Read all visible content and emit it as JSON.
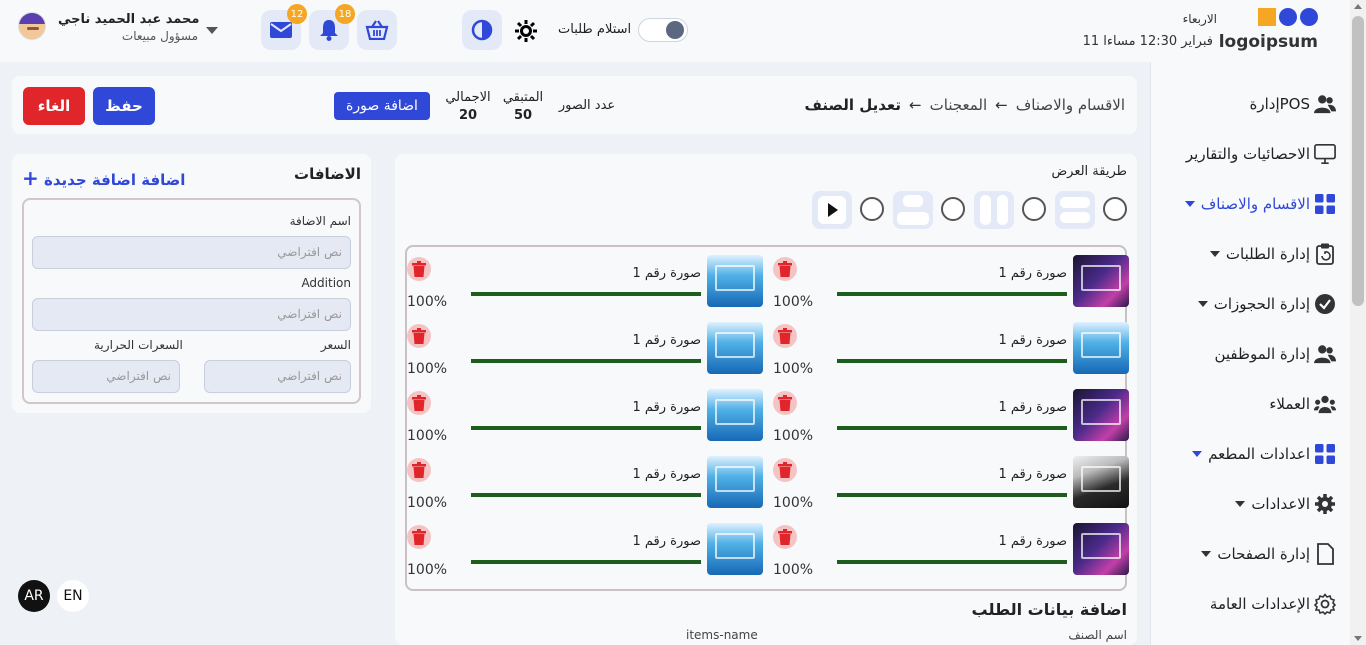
{
  "user": {
    "name": "محمد عبد الحميد ناجي",
    "role": "مسؤول مبيعات"
  },
  "notifications": {
    "messages_count": "12",
    "alerts_count": "18"
  },
  "toggle": {
    "label": "استلام طلبات"
  },
  "brand": {
    "day": "الاربعاء",
    "logo_text": "logoipsum",
    "date": "11 فبراير 12:30 مساءا"
  },
  "sidebar": {
    "items": [
      {
        "label": "إدارةPOS"
      },
      {
        "label": "الاحصائيات والتقارير"
      },
      {
        "label": "الاقسام والاصناف"
      },
      {
        "label": "إدارة الطلبات"
      },
      {
        "label": "إدارة الحجوزات"
      },
      {
        "label": "إدارة الموظفين"
      },
      {
        "label": "العملاء"
      },
      {
        "label": "اعدادات المطعم"
      },
      {
        "label": "الاعدادات"
      },
      {
        "label": "إدارة الصفحات"
      },
      {
        "label": "الإعدادات العامة"
      }
    ]
  },
  "header": {
    "cancel_label": "الغاء",
    "save_label": "حفظ",
    "add_image_label": "اضافة صورة",
    "total_label": "الاجمالي",
    "total_value": "20",
    "remaining_label": "المتبقي",
    "remaining_value": "50",
    "images_count_label": "عدد الصور",
    "breadcrumb": [
      "الاقسام والاصناف",
      "المعجنات",
      "تعديل الصنف"
    ]
  },
  "additions": {
    "title": "الاضافات",
    "add_new_label": "اضافة اضافة جديدة",
    "add_new_icon": "+",
    "fields": {
      "name_label": "اسم الاضافة",
      "addition_label": "Addition",
      "price_label": "السعر",
      "calories_label": "السعرات الحرارية",
      "placeholder": "نص افتراضي"
    }
  },
  "main": {
    "view_mode_label": "طريقة العرض",
    "images": [
      {
        "label": "صورة رقم 1",
        "percent": "100%",
        "progress": 1.0,
        "thumb": "gaming"
      },
      {
        "label": "صورة رقم 1",
        "percent": "100%",
        "progress": 1.0,
        "thumb": "laptop"
      },
      {
        "label": "صورة رقم 1",
        "percent": "100%",
        "progress": 1.0,
        "thumb": "laptop"
      },
      {
        "label": "صورة رقم 1",
        "percent": "100%",
        "progress": 1.0,
        "thumb": "laptop"
      },
      {
        "label": "صورة رقم 1",
        "percent": "100%",
        "progress": 1.0,
        "thumb": "gaming"
      },
      {
        "label": "صورة رقم 1",
        "percent": "100%",
        "progress": 1.0,
        "thumb": "laptop"
      },
      {
        "label": "صورة رقم 1",
        "percent": "100%",
        "progress": 1.0,
        "thumb": "dark"
      },
      {
        "label": "صورة رقم 1",
        "percent": "100%",
        "progress": 1.0,
        "thumb": "laptop"
      },
      {
        "label": "صورة رقم 1",
        "percent": "100%",
        "progress": 1.0,
        "thumb": "gaming"
      },
      {
        "label": "صورة رقم 1",
        "percent": "100%",
        "progress": 1.0,
        "thumb": "laptop"
      }
    ],
    "order_section_title": "اضافة بيانات الطلب",
    "item_name_label": "اسم الصنف",
    "item_name_en_label": "items-name"
  },
  "lang": {
    "ar": "AR",
    "en": "EN"
  },
  "colors": {
    "primary": "#2f48d8",
    "danger": "#e0262b",
    "accent": "#f5a623",
    "progress": "#1d5e1f"
  }
}
